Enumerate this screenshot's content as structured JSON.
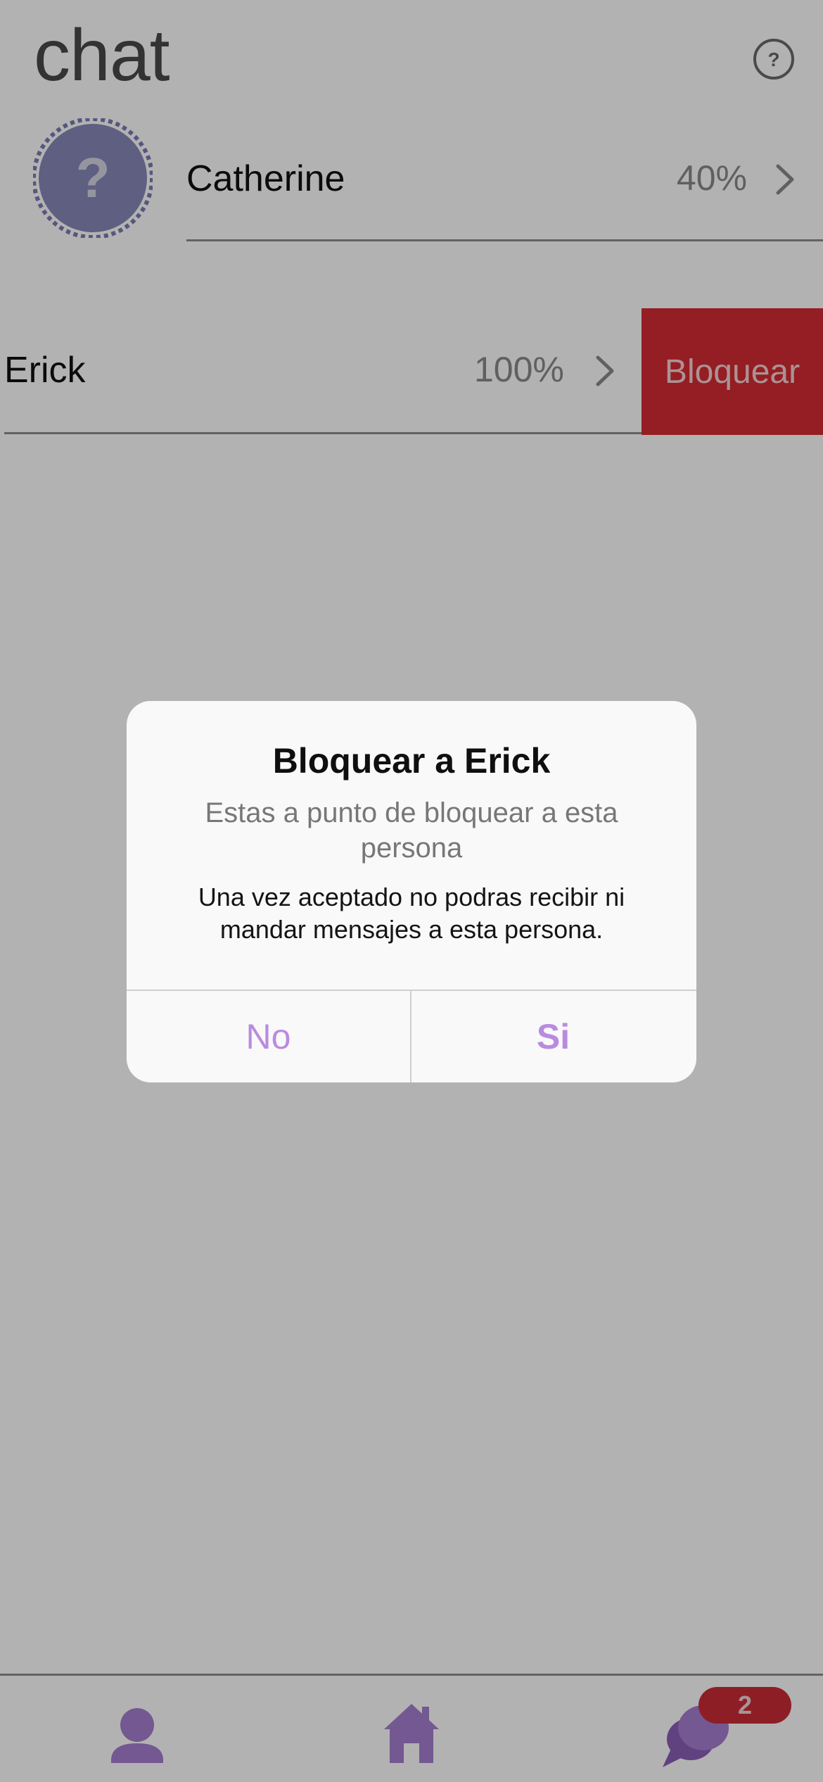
{
  "header": {
    "title": "chat"
  },
  "chats": [
    {
      "name": "Catherine",
      "percent": "40%"
    },
    {
      "name": "Erick",
      "percent": "100%",
      "action": "Bloquear"
    }
  ],
  "dialog": {
    "title": "Bloquear a Erick",
    "subtitle": "Estas a punto de bloquear a esta persona",
    "message": "Una vez aceptado no podras recibir ni mandar mensajes a esta persona.",
    "cancel_label": "No",
    "confirm_label": "Si"
  },
  "tabbar": {
    "items": [
      {
        "icon": "profile-icon"
      },
      {
        "icon": "home-icon"
      },
      {
        "icon": "chat-bubbles-icon"
      }
    ],
    "badge": "2"
  },
  "colors": {
    "accent_purple": "#b98be0",
    "danger_red": "#d42b33",
    "avatar_purple": "#7c7cb5"
  }
}
